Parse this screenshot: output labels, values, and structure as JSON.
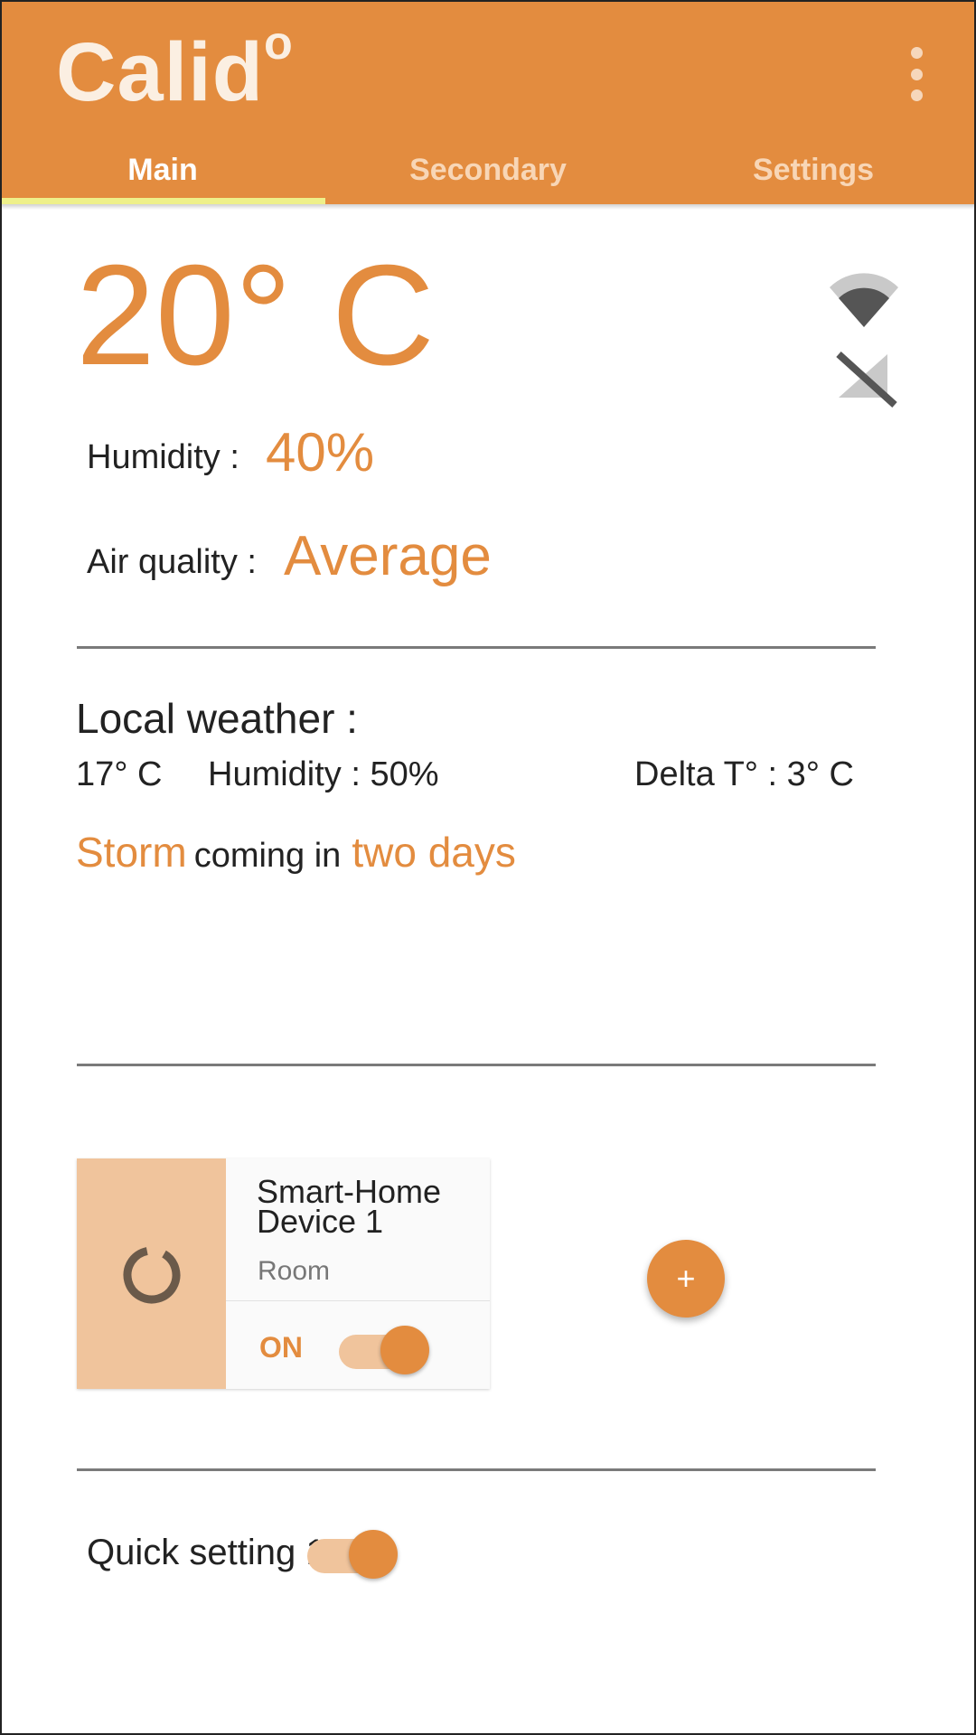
{
  "app": {
    "title": "Calid",
    "title_sup": "o",
    "accent_color": "#E38C3F",
    "menu_icon": "more-vert-icon"
  },
  "tabs": [
    {
      "label": "Main",
      "active": true
    },
    {
      "label": "Secondary",
      "active": false
    },
    {
      "label": "Settings",
      "active": false
    }
  ],
  "current": {
    "temperature": "20° C",
    "humidity_label": "Humidity :",
    "humidity_value": "40%",
    "air_label": "Air quality :",
    "air_value": "Average",
    "status_icons": [
      "wifi-icon",
      "signal-off-icon"
    ]
  },
  "weather": {
    "title": "Local weather :",
    "temperature": "17° C",
    "humidity": "Humidity : 50%",
    "delta": "Delta T° : 3° C",
    "forecast_event": "Storm",
    "forecast_connector": "coming in",
    "forecast_time": "two days"
  },
  "device": {
    "name": "Smart-Home Device 1",
    "room": "Room",
    "state": "ON",
    "on": true,
    "icon": "loading-icon"
  },
  "fab": {
    "label": "+"
  },
  "quick_setting": {
    "label": "Quick setting 1",
    "on": true
  }
}
